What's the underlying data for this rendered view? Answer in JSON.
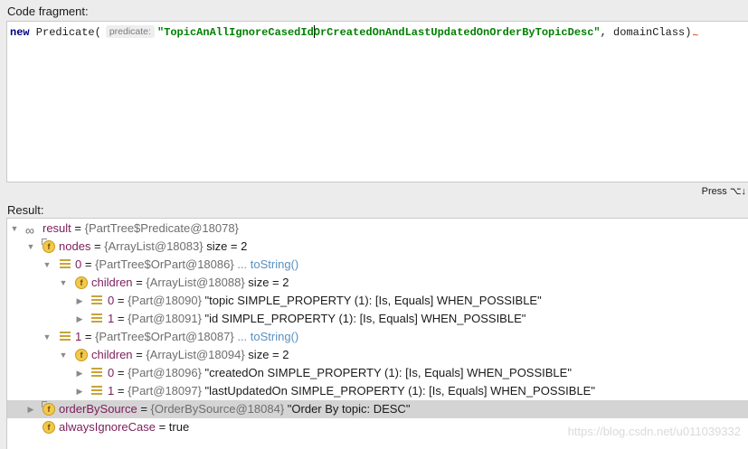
{
  "code_fragment": {
    "label": "Code fragment:",
    "keyword": "new",
    "class_open": " Predicate(",
    "param_hint": "predicate:",
    "string_before_caret": "\"TopicAnAllIgnoreCasedId",
    "string_after_caret": "OrCreatedOnAndLastUpdatedOnOrderByTopicDesc\"",
    "tail": ", domainClass)"
  },
  "shortcut_hint": "Press ⌥↓",
  "result": {
    "label": "Result:",
    "rows": [
      {
        "name": "result",
        "eq": " = ",
        "ref": "{PartTree$Predicate@18078}",
        "extra": ""
      },
      {
        "name": "nodes",
        "eq": " = ",
        "ref": "{ArrayList@18083}",
        "extra": "  size = 2"
      },
      {
        "name": "0",
        "eq": " = ",
        "ref": "{PartTree$OrPart@18086}",
        "extra": "",
        "link": " ... toString()"
      },
      {
        "name": "children",
        "eq": " = ",
        "ref": "{ArrayList@18088}",
        "extra": "  size = 2"
      },
      {
        "name": "0",
        "eq": " = ",
        "ref": "{Part@18090}",
        "extra": " \"topic SIMPLE_PROPERTY (1): [Is, Equals] WHEN_POSSIBLE\""
      },
      {
        "name": "1",
        "eq": " = ",
        "ref": "{Part@18091}",
        "extra": " \"id SIMPLE_PROPERTY (1): [Is, Equals] WHEN_POSSIBLE\""
      },
      {
        "name": "1",
        "eq": " = ",
        "ref": "{PartTree$OrPart@18087}",
        "extra": "",
        "link": " ... toString()"
      },
      {
        "name": "children",
        "eq": " = ",
        "ref": "{ArrayList@18094}",
        "extra": "  size = 2"
      },
      {
        "name": "0",
        "eq": " = ",
        "ref": "{Part@18096}",
        "extra": " \"createdOn SIMPLE_PROPERTY (1): [Is, Equals] WHEN_POSSIBLE\""
      },
      {
        "name": "1",
        "eq": " = ",
        "ref": "{Part@18097}",
        "extra": " \"lastUpdatedOn SIMPLE_PROPERTY (1): [Is, Equals] WHEN_POSSIBLE\""
      },
      {
        "name": "orderBySource",
        "eq": " = ",
        "ref": "{OrderBySource@18084}",
        "extra": " \"Order By topic: DESC\""
      },
      {
        "name": "alwaysIgnoreCase",
        "eq": " = ",
        "ref": "",
        "extra": "true"
      }
    ]
  },
  "watermark": "https://blog.csdn.net/u011039332",
  "icons": {
    "expanded": "triangle-down-icon",
    "collapsed": "triangle-right-icon",
    "field": "field-f-icon",
    "list": "list-element-icon",
    "watch": "watch-glasses-icon"
  },
  "colors": {
    "keyword": "#000080",
    "string": "#008000",
    "field_name": "#7b1e5b",
    "link": "#5a8fbf",
    "selection": "#d4d4d4"
  }
}
